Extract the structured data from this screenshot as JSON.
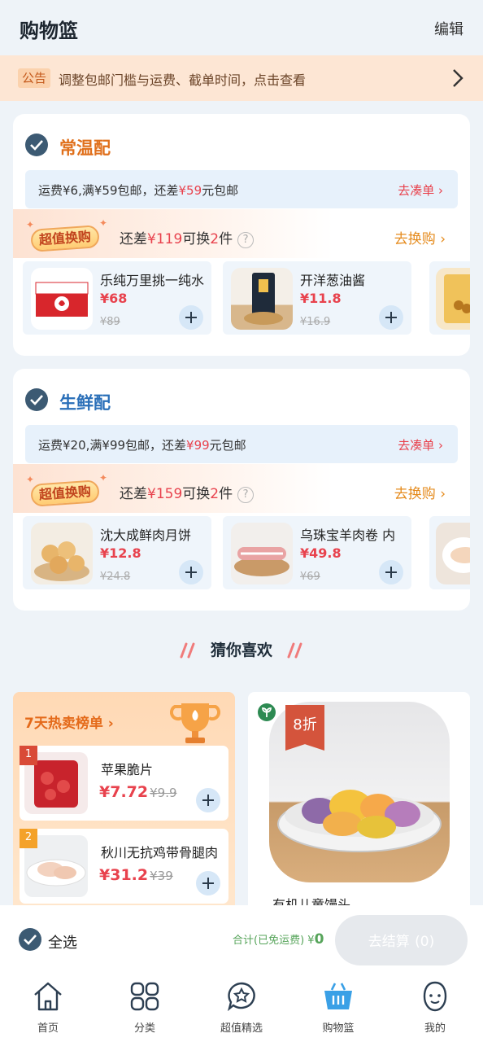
{
  "header": {
    "title": "购物篮",
    "edit": "编辑"
  },
  "notice": {
    "tag": "公告",
    "text": "调整包邮门槛与运费、截单时间，点击查看"
  },
  "sections": [
    {
      "title": "常温配",
      "title_color": "#e0701c",
      "shipping": {
        "prefix": "运费¥6,满¥59包邮，还差",
        "amount": "¥59",
        "suffix": "元包邮",
        "link": "去凑单"
      },
      "swap": {
        "badge": "超值换购",
        "pre": "还差",
        "amount": "¥119",
        "mid": "可换",
        "count": "2",
        "post": "件",
        "link": "去换购"
      },
      "products": [
        {
          "name": "乐纯万里挑一纯水",
          "price": "¥68",
          "old": "¥89"
        },
        {
          "name": "开洋葱油酱",
          "price": "¥11.8",
          "old": "¥16.9"
        }
      ]
    },
    {
      "title": "生鲜配",
      "title_color": "#2a6fb8",
      "shipping": {
        "prefix": "运费¥20,满¥99包邮，还差",
        "amount": "¥99",
        "suffix": "元包邮",
        "link": "去凑单"
      },
      "swap": {
        "badge": "超值换购",
        "pre": "还差",
        "amount": "¥159",
        "mid": "可换",
        "count": "2",
        "post": "件",
        "link": "去换购"
      },
      "products": [
        {
          "name": "沈大成鲜肉月饼",
          "price": "¥12.8",
          "old": "¥24.8"
        },
        {
          "name": "乌珠宝羊肉卷 内",
          "price": "¥49.8",
          "old": "¥69"
        }
      ]
    }
  ],
  "recommend": {
    "title": "猜你喜欢",
    "hot": {
      "title": "7天热卖榜单",
      "items": [
        {
          "rank": "1",
          "name": "苹果脆片",
          "price": "¥7.72",
          "old": "¥9.9"
        },
        {
          "rank": "2",
          "name": "秋川无抗鸡带骨腿肉",
          "price": "¥31.2",
          "old": "¥39"
        }
      ]
    },
    "featured": {
      "discount": "8折",
      "name": "有机儿童馒头"
    }
  },
  "bottom": {
    "select_all": "全选",
    "total_label": "合计(已免运费) ¥",
    "total": "0",
    "checkout": "去结算",
    "checkout_count": "(0)"
  },
  "tabs": [
    {
      "label": "首页",
      "icon": "home-icon"
    },
    {
      "label": "分类",
      "icon": "category-icon"
    },
    {
      "label": "超值精选",
      "icon": "star-bubble-icon"
    },
    {
      "label": "购物篮",
      "icon": "basket-icon"
    },
    {
      "label": "我的",
      "icon": "profile-icon"
    }
  ],
  "colors": {
    "accent": "#e8424d",
    "check": "#3c5a73",
    "active_tab": "#3aa0e6"
  }
}
